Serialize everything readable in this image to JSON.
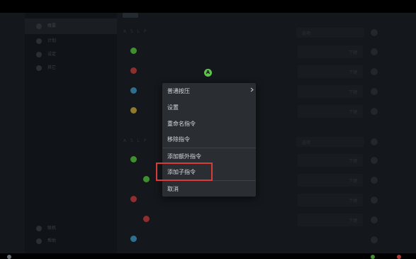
{
  "sidebar": {
    "items": [
      {
        "label": "概要"
      },
      {
        "label": "计划"
      },
      {
        "label": "设定"
      },
      {
        "label": "其它"
      }
    ],
    "bottom_items": [
      {
        "label": "联机"
      },
      {
        "label": "帮助"
      }
    ]
  },
  "main": {
    "section_labels": [
      "A  S  L  P",
      "A  S  L  P"
    ],
    "dropdowns": [
      {
        "value": "选项"
      },
      {
        "value": "选项"
      }
    ],
    "row_fields": [
      "下键",
      "下键",
      "下键",
      "下键",
      "下键",
      "下键",
      "下键",
      "下键"
    ],
    "dot_colors": [
      "#3f8f2e",
      "#8f2e2e",
      "#2e6f8f",
      "#8f7a2e",
      "#3f8f2e",
      "#8f2e2e",
      "#8f2e2e",
      "#2e6f8f"
    ]
  },
  "marker": {
    "label": "A",
    "color": "#5fc24b"
  },
  "context_menu": {
    "items": [
      {
        "label": "普通按压",
        "submenu": true
      },
      {
        "label": "设置"
      },
      {
        "label": "重命名指令"
      },
      {
        "label": "移除指令"
      },
      {
        "label": "添加额外指令"
      },
      {
        "label": "添加子指令"
      },
      {
        "label": "取消"
      }
    ]
  },
  "highlight_color": "#d93a3a"
}
